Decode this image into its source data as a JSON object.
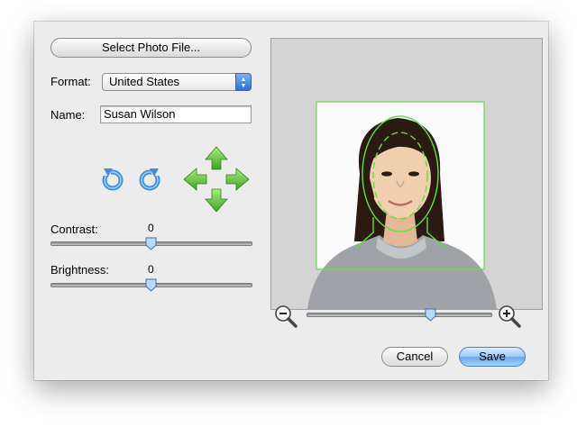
{
  "left_panel": {
    "select_photo_label": "Select Photo File...",
    "format_label": "Format:",
    "format_value": "United States",
    "name_label": "Name:",
    "name_value": "Susan Wilson"
  },
  "adjustments": {
    "contrast_label": "Contrast:",
    "contrast_value": "0",
    "brightness_label": "Brightness:",
    "brightness_value": "0"
  },
  "icons": {
    "rotate_left": "rotate-left-icon",
    "rotate_right": "rotate-right-icon",
    "move": "move-arrows-icon",
    "zoom_out": "zoom-out-icon",
    "zoom_in": "zoom-in-icon"
  },
  "colors": {
    "guide_green": "#66dd44",
    "arrow_green": "#4db82f",
    "rotate_blue": "#3d8ee0",
    "default_button": "#6aa6ea"
  },
  "buttons": {
    "cancel_label": "Cancel",
    "save_label": "Save"
  }
}
